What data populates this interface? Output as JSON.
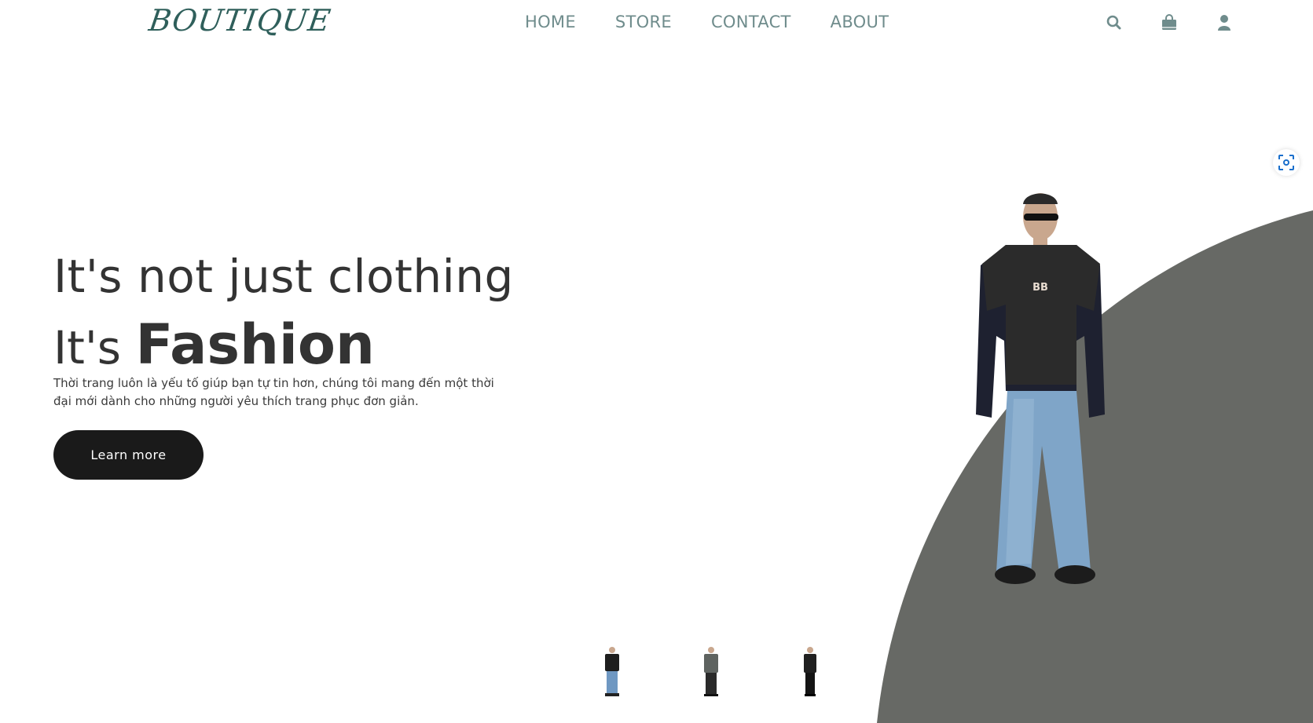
{
  "header": {
    "logo": "BOUTIQUE",
    "nav": [
      "HOME",
      "STORE",
      "CONTACT",
      "ABOUT"
    ],
    "icons": [
      "search-icon",
      "shopping-bag-icon",
      "user-icon"
    ]
  },
  "hero": {
    "line1": "It's not just clothing",
    "line2_prefix": "It's ",
    "line2_bold": "Fashion",
    "description": "Thời trang luôn là yếu tố giúp bạn tự tin hơn, chúng tôi mang đến một thời đại mới dành cho những người yêu thích trang phục đơn giản.",
    "cta_label": "Learn more"
  },
  "colors": {
    "logo": "#2f5f5b",
    "nav": "#6f8c8c",
    "shape": "#676965",
    "button": "#1a1a1a"
  },
  "thumbnails": [
    "thumbnail-1",
    "thumbnail-2",
    "thumbnail-3"
  ]
}
